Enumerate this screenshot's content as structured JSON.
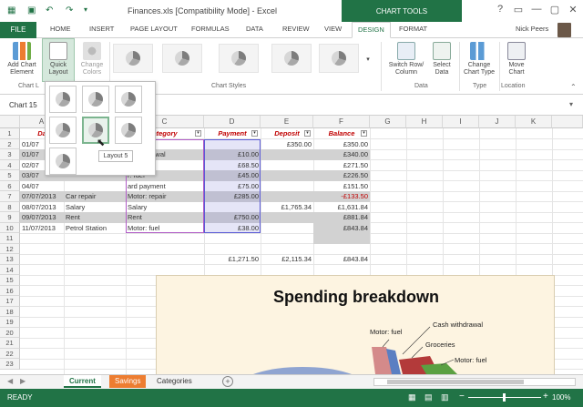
{
  "window": {
    "title": "Finances.xls [Compatibility Mode] - Excel",
    "chart_tools": "CHART TOOLS",
    "user": "Nick Peers",
    "controls": [
      "?",
      "▭",
      "—",
      "▢",
      "✕"
    ]
  },
  "tabs": [
    "FILE",
    "HOME",
    "INSERT",
    "PAGE LAYOUT",
    "FORMULAS",
    "DATA",
    "REVIEW",
    "VIEW",
    "DESIGN",
    "FORMAT"
  ],
  "ribbon": {
    "add_chart_element": "Add Chart Element",
    "quick_layout": "Quick Layout",
    "change_colors": "Change Colors",
    "chart_styles_label": "Chart Styles",
    "chart_layouts_label": "Chart L",
    "switch_row_column": "Switch Row/ Column",
    "select_data": "Select Data",
    "data_label": "Data",
    "change_chart_type": "Change Chart Type",
    "type_label": "Type",
    "move_chart": "Move Chart",
    "location_label": "Location"
  },
  "namebox": "Chart 15",
  "columns": [
    "A",
    "B",
    "C",
    "D",
    "E",
    "F",
    "G",
    "H",
    "I",
    "J",
    "K"
  ],
  "rows": [
    "1",
    "2",
    "3",
    "4",
    "5",
    "6",
    "7",
    "8",
    "9",
    "10",
    "11",
    "12",
    "13",
    "14",
    "15",
    "16",
    "17",
    "18",
    "19",
    "20",
    "21",
    "22",
    "23"
  ],
  "headers": {
    "date": "Da",
    "category": "ategory",
    "payment": "Payment",
    "deposit": "Deposit",
    "balance": "Balance"
  },
  "table": [
    {
      "date": "01/07",
      "desc": "",
      "category": "",
      "payment": "",
      "deposit": "£350.00",
      "balance": "£350.00"
    },
    {
      "date": "01/07",
      "desc": "",
      "category": "h withdrawal",
      "payment": "£10.00",
      "deposit": "",
      "balance": "£340.00"
    },
    {
      "date": "02/07",
      "desc": "",
      "category": "ries",
      "payment": "£68.50",
      "deposit": "",
      "balance": "£271.50"
    },
    {
      "date": "03/07",
      "desc": "",
      "category": "r: fuel",
      "payment": "£45.00",
      "deposit": "",
      "balance": "£226.50"
    },
    {
      "date": "04/07",
      "desc": "",
      "category": "ard payment",
      "payment": "£75.00",
      "deposit": "",
      "balance": "£151.50"
    },
    {
      "date": "07/07/2013",
      "desc": "Car repair",
      "category": "Motor: repair",
      "payment": "£285.00",
      "deposit": "",
      "balance": "-£133.50"
    },
    {
      "date": "08/07/2013",
      "desc": "Salary",
      "category": "Salary",
      "payment": "",
      "deposit": "£1,765.34",
      "balance": "£1,631.84"
    },
    {
      "date": "09/07/2013",
      "desc": "Rent",
      "category": "Rent",
      "payment": "£750.00",
      "deposit": "",
      "balance": "£881.84"
    },
    {
      "date": "11/07/2013",
      "desc": "Petrol Station",
      "category": "Motor: fuel",
      "payment": "£38.00",
      "deposit": "",
      "balance": "£843.84"
    }
  ],
  "totals": {
    "payment": "£1,271.50",
    "deposit": "£2,115.34",
    "balance": "£843.84"
  },
  "chart": {
    "title": "Spending breakdown",
    "labels": [
      "Motor: fuel",
      "Cash withdrawal",
      "Groceries",
      "Motor: fuel"
    ]
  },
  "quick_layout_tooltip": "Layout 5",
  "sheets": [
    "Current",
    "Savings",
    "Categories"
  ],
  "sheet_add": "+",
  "status": {
    "ready": "READY",
    "zoom": "100%",
    "zoom_minus": "−",
    "zoom_plus": "+"
  }
}
